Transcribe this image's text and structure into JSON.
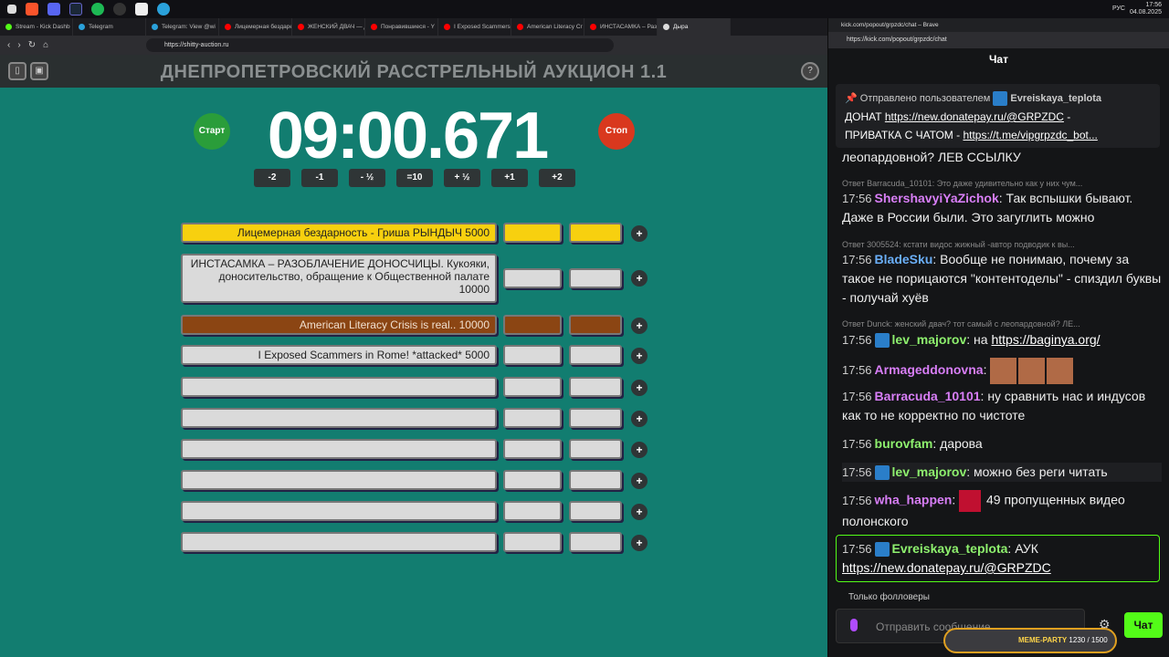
{
  "taskbar": {
    "time": "17:56",
    "date": "04.08.2025",
    "lang": "РУС"
  },
  "tabs_a": [
    "Stream - Kick Dashb",
    "Telegram",
    "Telegram: View @wi",
    "Лицемерная бездаре",
    "ЖЕНСКИЙ ДВАЧ — Д",
    "Понравившиеся - Y",
    "I Exposed Scammers",
    "American Literacy Cr",
    "ИНСТАСАМКА – Раз",
    "Дыра"
  ],
  "url_a": "https://shitty-auction.ru",
  "app": {
    "title": "ДНЕПРОПЕТРОВСКИЙ РАССТРЕЛЬНЫЙ АУКЦИОН 1.1",
    "timer": "09:00.671",
    "start": "Старт",
    "stop": "Стоп",
    "adj": [
      "-2",
      "-1",
      "- ½",
      "=10",
      "+ ½",
      "+1",
      "+2"
    ],
    "lots": [
      "Лицемерная бездарность - Гриша РЫНДЫЧ 5000",
      "ИНСТАСАМКА – РАЗОБЛАЧЕНИЕ ДОНОСЧИЦЫ. Кукояки, доносительство, обращение к Общественной палате 10000",
      "American Literacy Crisis is real.. 10000",
      "I Exposed Scammers in Rome! *attacked* 5000",
      "",
      "",
      "",
      "",
      "",
      ""
    ]
  },
  "chat": {
    "window_title": "kick.com/popout/grpzdc/chat – Brave",
    "url": "https://kick.com/popout/grpzdc/chat",
    "title": "Чат",
    "pinned_by": "Отправлено пользователем",
    "pinned_user": "Evreiskaya_teplota",
    "pinned_text1": "ДОНАТ",
    "pinned_link1": "https://new.donatepay.ru/@GRPZDC",
    "pinned_text2": "ПРИВАТКА С ЧАТОМ -",
    "pinned_link2": "https://t.me/vipgrpzdc_bot...",
    "top_frag": "леопардовной? ЛЕВ ССЫЛКУ",
    "r1": "Ответ Barracuda_10101: Это даже удивительно как у них чум...",
    "u1": "ShershavyiYaZichok",
    "m1": "Так вспышки бывают. Даже в России были. Это загуглить можно",
    "r2": "Ответ 3005524: кстати видос жижный -автор подводик к вы...",
    "u2": "BladeSku",
    "m2": "Вообще не понимаю, почему за такое не порицаются \"контентоделы\" - спиздил буквы - получай хуёв",
    "r3": "Ответ Dunck: женский двач? тот самый с леопардовной? ЛЕ...",
    "u3": "lev_majorov",
    "m3": "на",
    "l3": "https://baginya.org/",
    "u4": "Armageddonovna",
    "u5": "Barracuda_10101",
    "m5": "ну сравнить нас и индусов как то не корректно по чистоте",
    "u6": "burovfam",
    "m6": "дарова",
    "u7": "lev_majorov",
    "m7": "можно без реги читать",
    "u8": "wha_happen",
    "m8": "49 пропущенных видео полонского",
    "u9": "Evreiskaya_teplota",
    "m9": "АУК",
    "l9": "https://new.donatepay.ru/@GRPZDC",
    "t": "17:56",
    "followers": "Только фолловеры",
    "placeholder": "Отправить сообщение",
    "send": "Чат",
    "meme": "MEME-PARTY",
    "meme_count": "1230 / 1500"
  }
}
